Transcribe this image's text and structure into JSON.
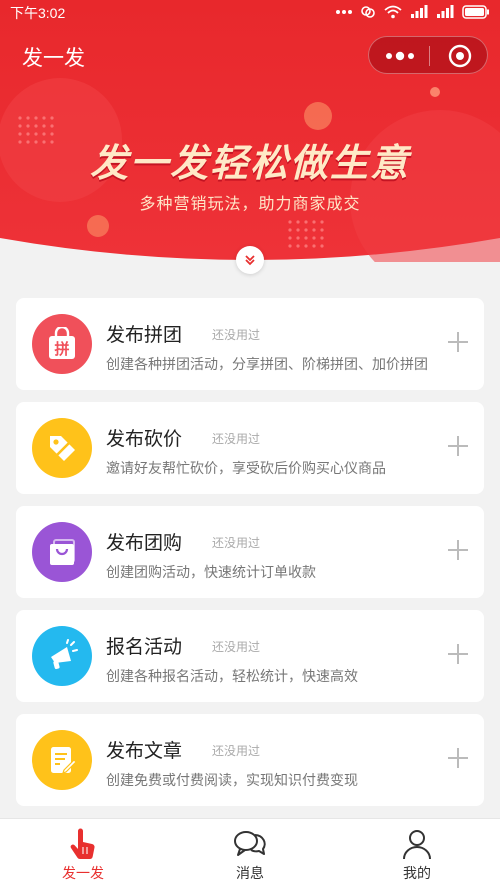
{
  "status_bar": {
    "time": "下午3:02"
  },
  "navbar": {
    "title": "发一发"
  },
  "hero": {
    "title": "发一发轻松做生意",
    "subtitle": "多种营销玩法，助力商家成交"
  },
  "colors": {
    "primary_red": "#e8302f",
    "hero_red": "#ea2a2d",
    "pintuan": "#f0505a",
    "kanjia": "#ffc21a",
    "tuangou": "#9a55d6",
    "baoming": "#24b9ef",
    "wenzhang": "#ffc21a"
  },
  "cards": [
    {
      "title": "发布拼团",
      "status": "还没用过",
      "desc": "创建各种拼团活动，分享拼团、阶梯拼团、加价拼团",
      "icon": "pintuan-bag-icon"
    },
    {
      "title": "发布砍价",
      "status": "还没用过",
      "desc": "邀请好友帮忙砍价，享受砍后价购买心仪商品",
      "icon": "price-tag-icon"
    },
    {
      "title": "发布团购",
      "status": "还没用过",
      "desc": "创建团购活动，快速统计订单收款",
      "icon": "shopping-bag-icon"
    },
    {
      "title": "报名活动",
      "status": "还没用过",
      "desc": "创建各种报名活动，轻松统计，快速高效",
      "icon": "megaphone-icon"
    },
    {
      "title": "发布文章",
      "status": "还没用过",
      "desc": "创建免费或付费阅读，实现知识付费变现",
      "icon": "article-edit-icon"
    }
  ],
  "tabbar": [
    {
      "label": "发一发"
    },
    {
      "label": "消息"
    },
    {
      "label": "我的"
    }
  ]
}
